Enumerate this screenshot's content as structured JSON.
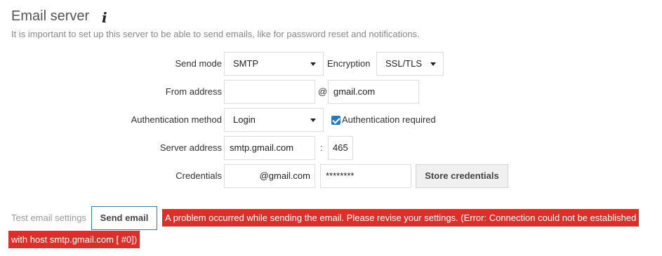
{
  "header": {
    "title": "Email server",
    "info_icon": "info-icon",
    "subtitle": "It is important to set up this server to be able to send emails, like for password reset and notifications."
  },
  "form": {
    "send_mode": {
      "label": "Send mode",
      "value": "SMTP"
    },
    "encryption": {
      "label": "Encryption",
      "value": "SSL/TLS"
    },
    "from_address": {
      "label": "From address",
      "local_value": "",
      "at": "@",
      "domain_value": "gmail.com"
    },
    "auth_method": {
      "label": "Authentication method",
      "value": "Login"
    },
    "auth_required": {
      "label": "Authentication required",
      "checked": true
    },
    "server_address": {
      "label": "Server address",
      "host": "smtp.gmail.com",
      "colon": ":",
      "port": "465"
    },
    "credentials": {
      "label": "Credentials",
      "username": "@gmail.com",
      "password": "********",
      "store_button": "Store credentials"
    }
  },
  "test": {
    "label": "Test email settings",
    "send_button": "Send email",
    "error_line1": "A problem occurred while sending the email. Please revise your settings. (Error: Connection could not be established",
    "error_line2": "with host smtp.gmail.com [ #0])",
    "error_color": "#d9302c"
  }
}
